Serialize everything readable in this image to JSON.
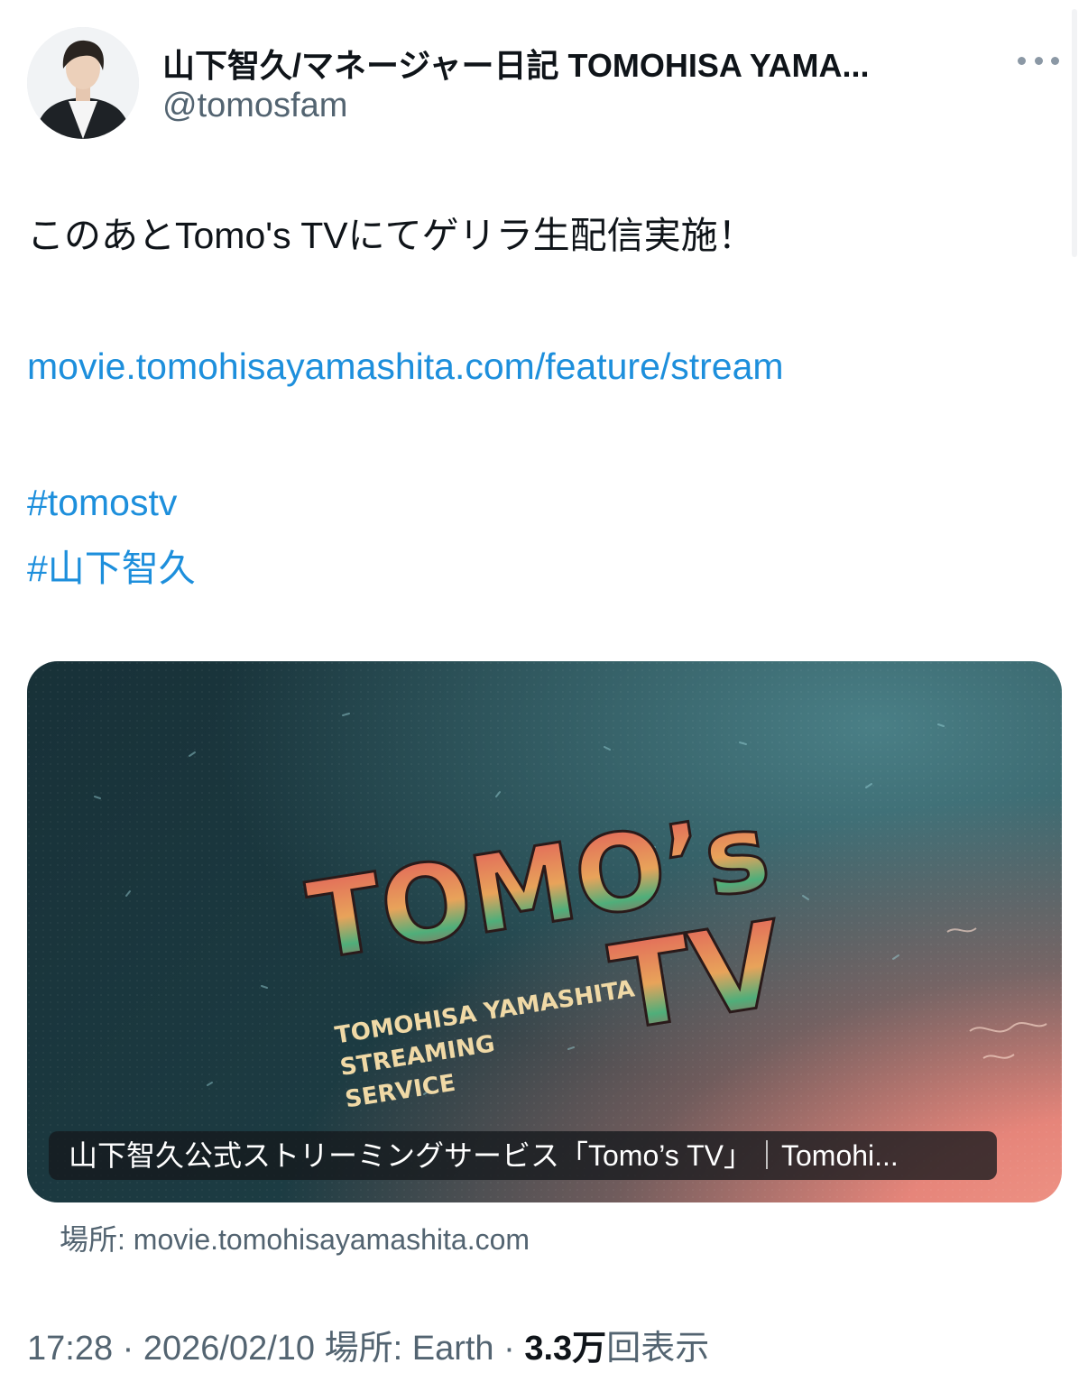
{
  "header": {
    "display_name": "山下智久/マネージャー日記 TOMOHISA YAMA...",
    "handle": "@tomosfam",
    "avatar_icon": "person-avatar-icon",
    "more_icon": "more-options-icon"
  },
  "post": {
    "text": "このあとTomo's TVにてゲリラ生配信実施！",
    "link": "movie.tomohisayamashita.com/feature/stream",
    "hashtags": [
      "#tomostv",
      "#山下智久"
    ]
  },
  "card": {
    "logo_line1": "TOMO’s",
    "logo_line2": "TV",
    "tagline": [
      "TOMOHISA YAMASHITA",
      "STREAMING",
      "SERVICE"
    ],
    "title": "山下智久公式ストリーミングサービス「Tomo’s TV」｜Tomohi...",
    "source": "場所: movie.tomohisayamashita.com",
    "colors": {
      "logo_red": "#e0565a",
      "logo_green": "#4fae7a",
      "logo_orange": "#e8a35a",
      "tagline": "#f0d9a6"
    }
  },
  "meta": {
    "time": "17:28",
    "sep1": " · ",
    "date": "2026/02/10",
    "location": "場所: Earth",
    "sep2": " · ",
    "views_count": "3.3万",
    "views_label": "回表示"
  },
  "colors": {
    "link": "#1d8fdc",
    "secondary_text": "#536471",
    "primary_text": "#0f1419"
  }
}
